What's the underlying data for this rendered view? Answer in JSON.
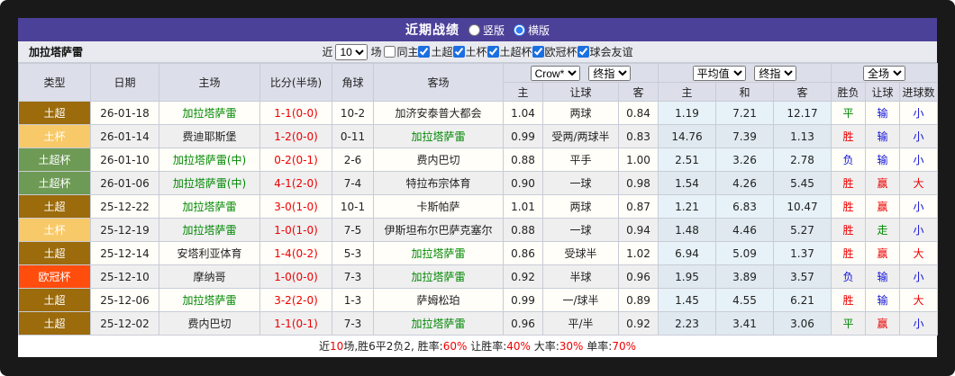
{
  "title_bar": {
    "title": "近期战绩",
    "bg": "#4C4199",
    "radios": [
      {
        "label": "竖版",
        "checked": false
      },
      {
        "label": "横版",
        "checked": true
      }
    ]
  },
  "filter_bar": {
    "team": "加拉塔萨雷",
    "near_label": "近",
    "matches_label": "场",
    "count_value": "10",
    "checkboxes": [
      {
        "label": "同主",
        "checked": false
      },
      {
        "label": "土超",
        "checked": true
      },
      {
        "label": "土杯",
        "checked": true
      },
      {
        "label": "土超杯",
        "checked": true
      },
      {
        "label": "欧冠杯",
        "checked": true
      },
      {
        "label": "球会友谊",
        "checked": true
      }
    ]
  },
  "table": {
    "selects": {
      "bookmaker": "Crow*",
      "bookmaker_final": "终指",
      "average": "平均值",
      "average_final": "终指",
      "scope": "全场"
    },
    "header_left": [
      "类型",
      "日期",
      "主场",
      "比分(半场)",
      "角球",
      "客场"
    ],
    "header_sub": [
      "主",
      "让球",
      "客",
      "主",
      "和",
      "客",
      "胜负",
      "让球",
      "进球数"
    ],
    "type_colors": {
      "土超": "#9B6B0C",
      "土杯": "#F8C969",
      "土超杯": "#6D9A54",
      "欧冠杯": "#FF4D0E"
    },
    "result_colors": {
      "胜": "c-red",
      "赢": "c-red",
      "大": "c-red",
      "平": "c-green",
      "走": "c-green",
      "负": "c-blue",
      "输": "c-blue",
      "小": "c-blue"
    },
    "rows": [
      {
        "type": "土超",
        "date": "26-01-18",
        "home": "加拉塔萨雷",
        "home_green": true,
        "score": "1-1(0-0)",
        "corner": "10-2",
        "away": "加济安泰普大都会",
        "away_green": false,
        "crow_home": "1.04",
        "handicap": "两球",
        "crow_away": "0.84",
        "avg_home": "1.19",
        "avg_draw": "7.21",
        "avg_away": "12.17",
        "result": "平",
        "handicap_result": "输",
        "goals": "小"
      },
      {
        "type": "土杯",
        "date": "26-01-14",
        "home": "费迪耶斯堡",
        "home_green": false,
        "score": "1-2(0-0)",
        "corner": "0-11",
        "away": "加拉塔萨雷",
        "away_green": true,
        "crow_home": "0.99",
        "handicap": "受两/两球半",
        "crow_away": "0.83",
        "avg_home": "14.76",
        "avg_draw": "7.39",
        "avg_away": "1.13",
        "result": "胜",
        "handicap_result": "输",
        "goals": "小"
      },
      {
        "type": "土超杯",
        "date": "26-01-10",
        "home": "加拉塔萨雷(中)",
        "home_green": true,
        "score": "0-2(0-1)",
        "corner": "2-6",
        "away": "费内巴切",
        "away_green": false,
        "crow_home": "0.88",
        "handicap": "平手",
        "crow_away": "1.00",
        "avg_home": "2.51",
        "avg_draw": "3.26",
        "avg_away": "2.78",
        "result": "负",
        "handicap_result": "输",
        "goals": "小"
      },
      {
        "type": "土超杯",
        "date": "26-01-06",
        "home": "加拉塔萨雷(中)",
        "home_green": true,
        "score": "4-1(2-0)",
        "corner": "7-4",
        "away": "特拉布宗体育",
        "away_green": false,
        "crow_home": "0.90",
        "handicap": "一球",
        "crow_away": "0.98",
        "avg_home": "1.54",
        "avg_draw": "4.26",
        "avg_away": "5.45",
        "result": "胜",
        "handicap_result": "赢",
        "goals": "大"
      },
      {
        "type": "土超",
        "date": "25-12-22",
        "home": "加拉塔萨雷",
        "home_green": true,
        "score": "3-0(1-0)",
        "corner": "10-1",
        "away": "卡斯帕萨",
        "away_green": false,
        "crow_home": "1.01",
        "handicap": "两球",
        "crow_away": "0.87",
        "avg_home": "1.21",
        "avg_draw": "6.83",
        "avg_away": "10.47",
        "result": "胜",
        "handicap_result": "赢",
        "goals": "小"
      },
      {
        "type": "土杯",
        "date": "25-12-19",
        "home": "加拉塔萨雷",
        "home_green": true,
        "score": "1-0(1-0)",
        "corner": "7-5",
        "away": "伊斯坦布尔巴萨克塞尔",
        "away_green": false,
        "crow_home": "0.88",
        "handicap": "一球",
        "crow_away": "0.94",
        "avg_home": "1.48",
        "avg_draw": "4.46",
        "avg_away": "5.27",
        "result": "胜",
        "handicap_result": "走",
        "goals": "小"
      },
      {
        "type": "土超",
        "date": "25-12-14",
        "home": "安塔利亚体育",
        "home_green": false,
        "score": "1-4(0-2)",
        "corner": "5-3",
        "away": "加拉塔萨雷",
        "away_green": true,
        "crow_home": "0.86",
        "handicap": "受球半",
        "crow_away": "1.02",
        "avg_home": "6.94",
        "avg_draw": "5.09",
        "avg_away": "1.37",
        "result": "胜",
        "handicap_result": "赢",
        "goals": "大"
      },
      {
        "type": "欧冠杯",
        "date": "25-12-10",
        "home": "摩纳哥",
        "home_green": false,
        "score": "1-0(0-0)",
        "corner": "7-3",
        "away": "加拉塔萨雷",
        "away_green": true,
        "crow_home": "0.92",
        "handicap": "半球",
        "crow_away": "0.96",
        "avg_home": "1.95",
        "avg_draw": "3.89",
        "avg_away": "3.57",
        "result": "负",
        "handicap_result": "输",
        "goals": "小"
      },
      {
        "type": "土超",
        "date": "25-12-06",
        "home": "加拉塔萨雷",
        "home_green": true,
        "score": "3-2(2-0)",
        "corner": "1-3",
        "away": "萨姆松珀",
        "away_green": false,
        "crow_home": "0.99",
        "handicap": "一/球半",
        "crow_away": "0.89",
        "avg_home": "1.45",
        "avg_draw": "4.55",
        "avg_away": "6.21",
        "result": "胜",
        "handicap_result": "输",
        "goals": "大"
      },
      {
        "type": "土超",
        "date": "25-12-02",
        "home": "费内巴切",
        "home_green": false,
        "score": "1-1(0-1)",
        "corner": "7-3",
        "away": "加拉塔萨雷",
        "away_green": true,
        "crow_home": "0.96",
        "handicap": "平/半",
        "crow_away": "0.92",
        "avg_home": "2.23",
        "avg_draw": "3.41",
        "avg_away": "3.06",
        "result": "平",
        "handicap_result": "赢",
        "goals": "小"
      }
    ]
  },
  "footer": {
    "segments": [
      {
        "text": "近",
        "red": false
      },
      {
        "text": "10",
        "red": true
      },
      {
        "text": "场,胜6平2负2, 胜率:",
        "red": false
      },
      {
        "text": "60%",
        "red": true
      },
      {
        "text": " 让胜率:",
        "red": false
      },
      {
        "text": "40%",
        "red": true
      },
      {
        "text": " 大率:",
        "red": false
      },
      {
        "text": "30%",
        "red": true
      },
      {
        "text": " 单率:",
        "red": false
      },
      {
        "text": "70%",
        "red": true
      }
    ]
  }
}
